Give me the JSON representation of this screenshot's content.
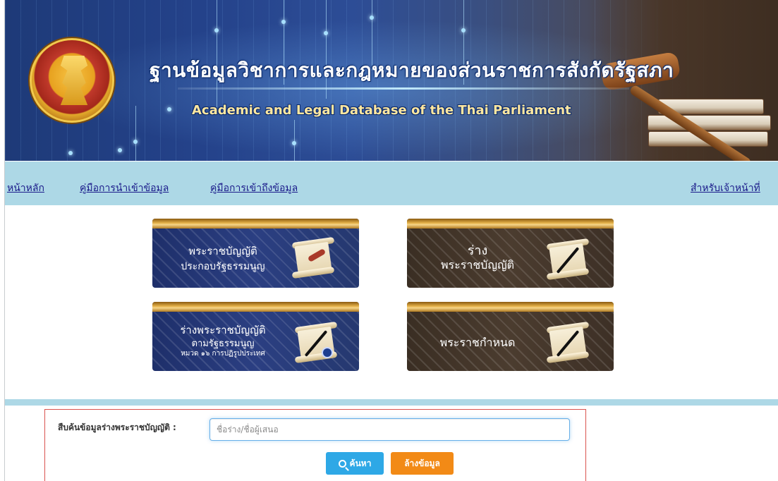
{
  "header": {
    "title_th": "ฐานข้อมูลวิชาการและกฎหมายของส่วนราชการสังกัดรัฐสภา",
    "title_en": "Academic and Legal Database of the Thai Parliament"
  },
  "nav": {
    "home": "หน้าหลัก",
    "import_manual": "คู่มือการนำเข้าข้อมูล",
    "access_manual": "คู่มือการเข้าถึงข้อมูล",
    "staff": "สำหรับเจ้าหน้าที่"
  },
  "tiles": [
    {
      "line1": "พระราชบัญญัติ",
      "line2": "ประกอบรัฐธรรมนูญ",
      "line3": "",
      "theme": "blue",
      "icon": "scroll-ribbon-icon"
    },
    {
      "line1": "ร่าง",
      "line2": "พระราชบัญญัติ",
      "line3": "",
      "theme": "brown",
      "icon": "scroll-pen-icon"
    },
    {
      "line1": "ร่างพระราชบัญญัติ",
      "line2": "ตามรัฐธรรมนูญ",
      "line3": "หมวด ๑๖ การปฏิรูปประเทศ",
      "theme": "blue",
      "icon": "scroll-seal-icon"
    },
    {
      "line1": "พระราชกำหนด",
      "line2": "",
      "line3": "",
      "theme": "brown",
      "icon": "scroll-pen-icon"
    }
  ],
  "search": {
    "label": "สืบค้นข้อมูลร่างพระราชบัญญัติ :",
    "placeholder": "ชื่อร่าง/ชื่อผู้เสนอ",
    "value": "",
    "search_button": "ค้นหา",
    "clear_button": "ล้างข้อมูล"
  },
  "colors": {
    "nav_background": "#add8e6",
    "search_button": "#2ea8e6",
    "clear_button": "#f28a16",
    "panel_border": "#d9534f"
  }
}
